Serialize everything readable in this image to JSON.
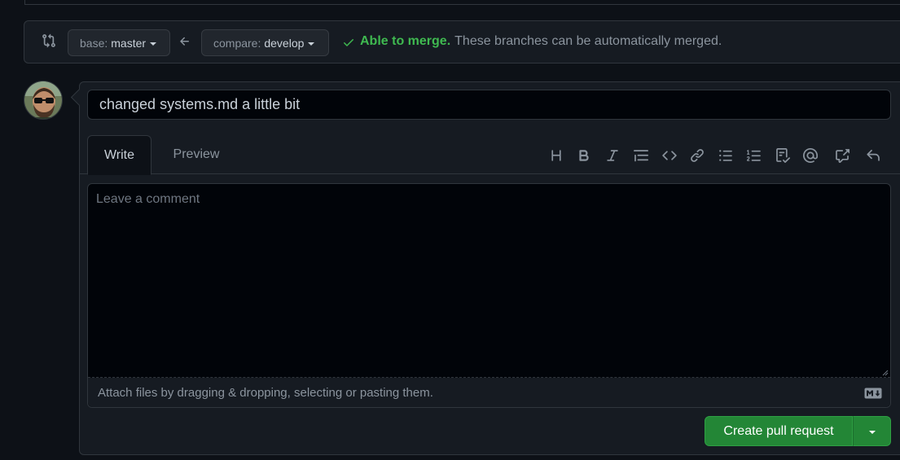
{
  "compare_bar": {
    "base_prefix": "base:",
    "base_branch": "master",
    "compare_prefix": "compare:",
    "compare_branch": "develop",
    "merge_ok": "Able to merge.",
    "merge_msg": "These branches can be automatically merged."
  },
  "form": {
    "title_value": "changed systems.md a little bit",
    "tabs": [
      {
        "label": "Write",
        "active": true
      },
      {
        "label": "Preview",
        "active": false
      }
    ],
    "toolbar_icons": [
      "heading-icon",
      "bold-icon",
      "italic-icon",
      "quote-icon",
      "code-icon",
      "link-icon",
      "bulleted-list-icon",
      "numbered-list-icon",
      "task-list-icon",
      "mention-icon",
      "cross-reference-icon",
      "reply-icon"
    ],
    "comment_placeholder": "Leave a comment",
    "attach_text": "Attach files by dragging & dropping, selecting or pasting them.",
    "submit_label": "Create pull request"
  },
  "colors": {
    "bg": "#0d1117",
    "panel": "#161b22",
    "border": "#30363d",
    "success": "#3fb950",
    "button_green": "#238636"
  }
}
